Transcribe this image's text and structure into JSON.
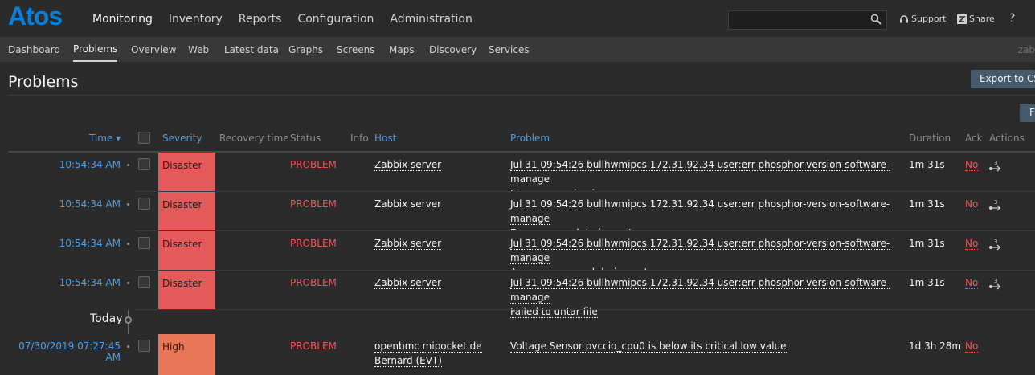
{
  "brand": {
    "logo": "Atos"
  },
  "main_nav": [
    "Monitoring",
    "Inventory",
    "Reports",
    "Configuration",
    "Administration"
  ],
  "top_links": {
    "support": "Support",
    "share": "Share",
    "help": "?"
  },
  "search": {
    "placeholder": ""
  },
  "sub_nav": [
    "Dashboard",
    "Problems",
    "Overview",
    "Web",
    "Latest data",
    "Graphs",
    "Screens",
    "Maps",
    "Discovery",
    "Services"
  ],
  "sub_nav_right": "zab",
  "page": {
    "title": "Problems",
    "export_button": "Export to CS",
    "filter_button": "F"
  },
  "table": {
    "headers": {
      "time": "Time ▾",
      "severity": "Severity",
      "recovery_time": "Recovery time",
      "status": "Status",
      "info": "Info",
      "host": "Host",
      "problem": "Problem",
      "duration": "Duration",
      "ack": "Ack",
      "actions": "Actions"
    },
    "rows": [
      {
        "time": "10:54:34 AM",
        "severity": "Disaster",
        "status": "PROBLEM",
        "host": "Zabbix server",
        "problem_line1": "Jul 31 09:54:26 bullhwmipcs 172.31.92.34 user:err phosphor-version-software-manage",
        "problem_line2": "Error processing image",
        "duration": "1m 31s",
        "ack": "No",
        "actions_count": "3"
      },
      {
        "time": "10:54:34 AM",
        "severity": "Disaster",
        "status": "PROBLEM",
        "host": "Zabbix server",
        "problem_line1": "Jul 31 09:54:26 bullhwmipcs 172.31.92.34 user:err phosphor-version-software-manage",
        "problem_line2": "Error occurred during untar",
        "duration": "1m 31s",
        "ack": "No",
        "actions_count": "3"
      },
      {
        "time": "10:54:34 AM",
        "severity": "Disaster",
        "status": "PROBLEM",
        "host": "Zabbix server",
        "problem_line1": "Jul 31 09:54:26 bullhwmipcs 172.31.92.34 user:err phosphor-version-software-manage",
        "problem_line2": "An error occurred during untar.",
        "duration": "1m 31s",
        "ack": "No",
        "actions_count": "3"
      },
      {
        "time": "10:54:34 AM",
        "severity": "Disaster",
        "status": "PROBLEM",
        "host": "Zabbix server",
        "problem_line1": "Jul 31 09:54:26 bullhwmipcs 172.31.92.34 user:err phosphor-version-software-manage",
        "problem_line2": "Failed to untar file",
        "duration": "1m 31s",
        "ack": "No",
        "actions_count": "3"
      }
    ],
    "separator": "Today",
    "row5": {
      "time": "07/30/2019 07:27:45 AM",
      "severity": "High",
      "status": "PROBLEM",
      "host_line1": "openbmc mipocket de",
      "host_line2": "Bernard (EVT)",
      "problem": "Voltage Sensor pvccio_cpu0 is below its critical low value",
      "duration": "1d 3h 28m",
      "ack": "No"
    }
  },
  "colors": {
    "disaster": "#e45959",
    "high": "#e97659",
    "link": "#4f9de1",
    "problem": "#e45959"
  }
}
